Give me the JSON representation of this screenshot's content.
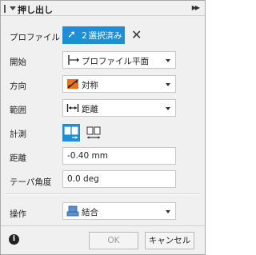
{
  "title": "押し出し",
  "profile": {
    "label": "プロファイル",
    "selection_text": "２選択済み"
  },
  "start": {
    "label": "開始",
    "value": "プロファイル平面"
  },
  "direction": {
    "label": "方向",
    "value": "対称"
  },
  "extent": {
    "label": "範囲",
    "value": "距離"
  },
  "measure": {
    "label": "計測"
  },
  "distance": {
    "label": "距離",
    "value": "-0.40 mm"
  },
  "taper": {
    "label": "テーパ角度",
    "value": "0.0 deg"
  },
  "operation": {
    "label": "操作",
    "value": "結合"
  },
  "buttons": {
    "ok": "OK",
    "cancel": "キャンセル"
  },
  "colors": {
    "accent": "#1e8fd6",
    "direction_icon": "#e8731a"
  },
  "icons": {
    "info": "info-icon",
    "clear": "close-icon",
    "cursor": "cursor-arrow-icon"
  }
}
